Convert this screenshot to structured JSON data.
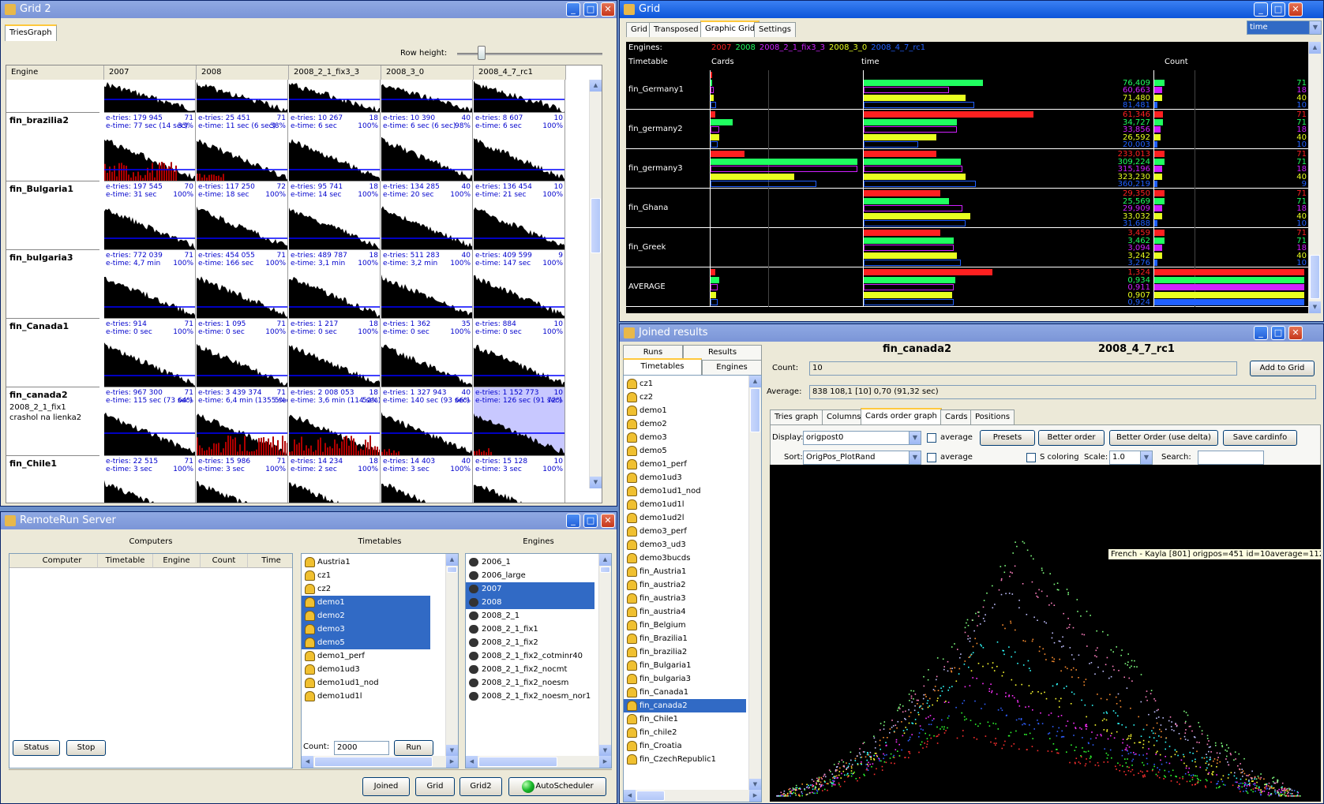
{
  "grid2": {
    "title": "Grid 2",
    "tab": "TriesGraph",
    "row_height_label": "Row height:",
    "col_engine": "Engine",
    "columns": [
      "2007",
      "2008",
      "2008_2_1_fix3_3",
      "2008_3_0",
      "2008_4_7_rc1"
    ],
    "rows": [
      {
        "name": "fin_brazilia2",
        "sub": "",
        "cells": [
          [
            "e-tries: 179 945",
            "71",
            "e-time: 77 sec  (14 sec)",
            "33%"
          ],
          [
            "e-tries: 25 451",
            "71",
            "e-time: 11 sec  (6 sec)",
            "38%"
          ],
          [
            "e-tries: 10 267",
            "18",
            "e-time: 6 sec",
            "100%"
          ],
          [
            "e-tries: 10 390",
            "40",
            "e-time: 6 sec  (6 sec)",
            "98%"
          ],
          [
            "e-tries: 8 607",
            "10",
            "e-time: 6 sec",
            "100%"
          ]
        ]
      },
      {
        "name": "fin_Bulgaria1",
        "sub": "",
        "cells": [
          [
            "e-tries: 197 545",
            "70",
            "e-time: 31 sec",
            "100%"
          ],
          [
            "e-tries: 117 250",
            "72",
            "e-time: 18 sec",
            "100%"
          ],
          [
            "e-tries: 95 741",
            "18",
            "e-time: 14 sec",
            "100%"
          ],
          [
            "e-tries: 134 285",
            "40",
            "e-time: 20 sec",
            "100%"
          ],
          [
            "e-tries: 136 454",
            "10",
            "e-time: 21 sec",
            "100%"
          ]
        ]
      },
      {
        "name": "fin_bulgaria3",
        "sub": "",
        "cells": [
          [
            "e-tries: 772 039",
            "71",
            "e-time: 4,7 min",
            "100%"
          ],
          [
            "e-tries: 454 055",
            "71",
            "e-time: 166 sec",
            "100%"
          ],
          [
            "e-tries: 489 787",
            "18",
            "e-time: 3,1 min",
            "100%"
          ],
          [
            "e-tries: 511 283",
            "40",
            "e-time: 3,2 min",
            "100%"
          ],
          [
            "e-tries: 409 599",
            "9",
            "e-time: 147 sec",
            "100%"
          ]
        ]
      },
      {
        "name": "fin_Canada1",
        "sub": "",
        "cells": [
          [
            "e-tries: 914",
            "71",
            "e-time: 0 sec",
            "100%"
          ],
          [
            "e-tries: 1 095",
            "71",
            "e-time: 0 sec",
            "100%"
          ],
          [
            "e-tries: 1 217",
            "18",
            "e-time: 0 sec",
            "100%"
          ],
          [
            "e-tries: 1 362",
            "35",
            "e-time: 0 sec",
            "100%"
          ],
          [
            "e-tries: 884",
            "10",
            "e-time: 0 sec",
            "100%"
          ]
        ]
      },
      {
        "name": "fin_canada2",
        "sub": "2008_2_1_fix1",
        "sub2": "crashol na lienka2",
        "cells": [
          [
            "e-tries: 967 300",
            "71",
            "e-time: 115 sec  (73 sec)",
            "64%"
          ],
          [
            "e-tries: 3 439 374",
            "71",
            "e-time: 6,4 min  (1355 sec)",
            "5%"
          ],
          [
            "e-tries: 2 008 053",
            "18",
            "e-time: 3,6 min  (114 sec)",
            "52%"
          ],
          [
            "e-tries: 1 327 943",
            "40",
            "e-time: 140 sec  (93 sec)",
            "66%"
          ],
          [
            "e-tries: 1 152 773",
            "10",
            "e-time: 126 sec  (91 sec)",
            "72%"
          ]
        ]
      },
      {
        "name": "fin_Chile1",
        "sub": "",
        "cells": [
          [
            "e-tries: 22 515",
            "71",
            "e-time: 3 sec",
            "100%"
          ],
          [
            "e-tries: 15 986",
            "71",
            "e-time: 3 sec",
            "100%"
          ],
          [
            "e-tries: 14 234",
            "18",
            "e-time: 2 sec",
            "100%"
          ],
          [
            "e-tries: 14 403",
            "40",
            "e-time: 3 sec",
            "100%"
          ],
          [
            "e-tries: 15 128",
            "10",
            "e-time: 3 sec",
            "100%"
          ]
        ]
      }
    ]
  },
  "grid": {
    "title": "Grid",
    "tabs": [
      "Grid",
      "Transposed",
      "Graphic Grid",
      "Settings"
    ],
    "combo": "time",
    "engines_label": "Engines:",
    "legend": [
      {
        "name": "2007",
        "color": "#ff2020"
      },
      {
        "name": "2008",
        "color": "#20ff60"
      },
      {
        "name": "2008_2_1_fix3_3",
        "color": "#d020ff"
      },
      {
        "name": "2008_3_0",
        "color": "#e8ff20"
      },
      {
        "name": "2008_4_7_rc1",
        "color": "#2060ff"
      }
    ],
    "hdr_timetable": "Timetable",
    "hdr_cards": "Cards",
    "hdr_time": "time",
    "hdr_count": "Count",
    "rows": [
      {
        "name": "fin_Germany1",
        "time": [
          "",
          "76,409",
          "60,663",
          "71,480",
          "81,481"
        ],
        "count": [
          "",
          "71",
          "18",
          "40",
          "10"
        ],
        "timebar": [
          0,
          0.7,
          0.5,
          0.6,
          0.65
        ],
        "cardbar": [
          0.01,
          0.01,
          0.02,
          0.02,
          0.04
        ],
        "countbar": [
          0,
          0.07,
          0.05,
          0.05,
          0.02
        ]
      },
      {
        "name": "fin_germany2",
        "time": [
          "61,346",
          "34,727",
          "33,856",
          "26,592",
          "20,003"
        ],
        "count": [
          "71",
          "71",
          "18",
          "40",
          "10"
        ],
        "timebar": [
          1.0,
          0.55,
          0.55,
          0.43,
          0.32
        ],
        "cardbar": [
          0.03,
          0.15,
          0.06,
          0.06,
          0.05
        ],
        "countbar": [
          0.06,
          0.06,
          0.04,
          0.04,
          0.02
        ]
      },
      {
        "name": "fin_germany3",
        "time": [
          "233,013",
          "309,224",
          "315,196",
          "323,230",
          "360,219"
        ],
        "count": [
          "71",
          "71",
          "18",
          "40",
          "9"
        ],
        "timebar": [
          0.43,
          0.57,
          0.58,
          0.6,
          0.66
        ],
        "cardbar": [
          0.23,
          1.0,
          1.0,
          0.57,
          0.72
        ],
        "countbar": [
          0.07,
          0.07,
          0.05,
          0.05,
          0.02
        ]
      },
      {
        "name": "fin_Ghana",
        "time": [
          "29,350",
          "25,569",
          "29,909",
          "33,032",
          "31,688"
        ],
        "count": [
          "71",
          "71",
          "18",
          "40",
          "10"
        ],
        "timebar": [
          0.45,
          0.5,
          0.58,
          0.63,
          0.6
        ],
        "cardbar": [
          0,
          0,
          0,
          0,
          0
        ],
        "countbar": [
          0.07,
          0.07,
          0.05,
          0.05,
          0.02
        ]
      },
      {
        "name": "fin_Greek",
        "time": [
          "3,459",
          "3,462",
          "3,094",
          "3,242",
          "3,276"
        ],
        "count": [
          "71",
          "71",
          "18",
          "40",
          "10"
        ],
        "timebar": [
          0.45,
          0.53,
          0.53,
          0.55,
          0.57
        ],
        "cardbar": [
          0,
          0,
          0,
          0,
          0
        ],
        "countbar": [
          0.07,
          0.07,
          0.05,
          0.05,
          0.02
        ]
      },
      {
        "name": "AVERAGE",
        "time": [
          "1,324",
          "0,934",
          "0,911",
          "0,907",
          "0,924"
        ],
        "count": [
          "",
          "",
          "",
          "",
          ""
        ],
        "timebar": [
          0.76,
          0.54,
          0.53,
          0.52,
          0.53
        ],
        "cardbar": [
          0.03,
          0.06,
          0.05,
          0.04,
          0.05
        ],
        "countbar": [
          1.0,
          1.0,
          1.0,
          1.0,
          1.0
        ]
      }
    ]
  },
  "joined": {
    "title": "Joined results",
    "tabs_top": [
      "Runs",
      "Results"
    ],
    "tabs_bottom": [
      "Timetables",
      "Engines"
    ],
    "timetables": [
      "cz1",
      "cz2",
      "demo1",
      "demo2",
      "demo3",
      "demo5",
      "demo1_perf",
      "demo1ud3",
      "demo1ud1_nod",
      "demo1ud1l",
      "demo1ud2l",
      "demo3_perf",
      "demo3_ud3",
      "demo3bucds",
      "fin_Austria1",
      "fin_austria2",
      "fin_austria3",
      "fin_austria4",
      "fin_Belgium",
      "fin_Brazilia1",
      "fin_brazilia2",
      "fin_Bulgaria1",
      "fin_bulgaria3",
      "fin_Canada1",
      "fin_canada2",
      "fin_Chile1",
      "fin_chile2",
      "fin_Croatia",
      "fin_CzechRepublic1"
    ],
    "selected": "fin_canada2",
    "header_timetable": "fin_canada2",
    "header_engine": "2008_4_7_rc1",
    "count_label": "Count:",
    "count_value": "10",
    "add_button": "Add to Grid",
    "average_label": "Average:",
    "average_value": "838 108,1 [10] 0,70     (91,32 sec)",
    "subtabs": [
      "Tries graph",
      "Columns",
      "Cards order graph",
      "Cards",
      "Positions"
    ],
    "display_label": "Display:",
    "display_value": "origpost0",
    "average_chk": "average",
    "presets": "Presets",
    "better_order": "Better order",
    "better_order_delta": "Better Order (use delta)",
    "save_cardinfo": "Save cardinfo",
    "sort_label": "Sort:",
    "sort_value": "OrigPos_PlotRand",
    "average_chk2": "average",
    "s_coloring": "S coloring",
    "scale_label": "Scale:",
    "scale_value": "1.0",
    "search_label": "Search:",
    "tooltip": "French - Kayla [801]  origpos=451 id=10average=112,7"
  },
  "server": {
    "title": "RemoteRun Server",
    "computers": "Computers",
    "timetables": "Timetables",
    "engines": "Engines",
    "cols": [
      "Computer",
      "Timetable",
      "Engine",
      "Count",
      "Time"
    ],
    "tt_items": [
      "Austria1",
      "cz1",
      "cz2",
      "demo1",
      "demo2",
      "demo3",
      "demo5",
      "demo1_perf",
      "demo1ud3",
      "demo1ud1_nod",
      "demo1ud1l"
    ],
    "tt_selected": [
      "demo1",
      "demo2",
      "demo3",
      "demo5"
    ],
    "eng_items": [
      "2006_1",
      "2006_large",
      "2007",
      "2008",
      "2008_2_1",
      "2008_2_1_fix1",
      "2008_2_1_fix2",
      "2008_2_1_fix2_cotminr40",
      "2008_2_1_fix2_nocmt",
      "2008_2_1_fix2_noesm",
      "2008_2_1_fix2_noesm_nor1"
    ],
    "eng_selected": [
      "2007",
      "2008"
    ],
    "status": "Status",
    "stop": "Stop",
    "count_label": "Count:",
    "count_value": "2000",
    "run": "Run",
    "joined": "Joined",
    "grid": "Grid",
    "grid2": "Grid2",
    "autoscheduler": "AutoScheduler"
  }
}
